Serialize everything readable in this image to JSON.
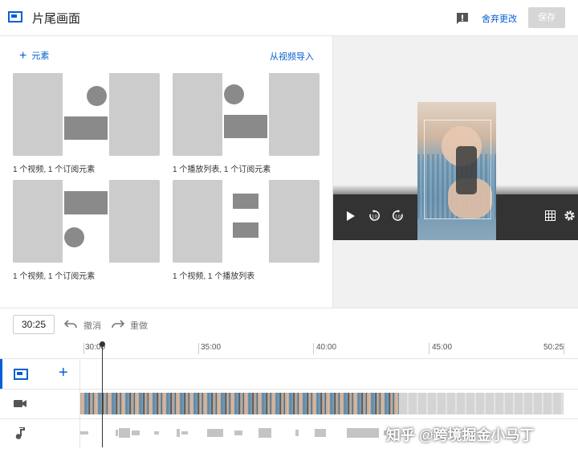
{
  "header": {
    "title": "片尾画面",
    "discard_label": "舍弃更改",
    "save_label": "保存"
  },
  "left_panel": {
    "add_element_label": "元素",
    "import_label": "从视频导入",
    "templates": [
      {
        "label": "1 个视频, 1 个订阅元素"
      },
      {
        "label": "1 个播放列表, 1 个订阅元素"
      },
      {
        "label": "1 个视频, 1 个订阅元素"
      },
      {
        "label": "1 个视频, 1 个播放列表"
      }
    ]
  },
  "timeline": {
    "current_time": "30:25",
    "undo_label": "撤消",
    "redo_label": "重做",
    "ruler_ticks": [
      "30:00",
      "35:00",
      "40:00",
      "45:00",
      "50:25"
    ]
  },
  "watermark": "知乎 @跨境掘金小马丁",
  "colors": {
    "accent": "#065fd4",
    "save_disabled": "#d6d6d6",
    "placeholder": "#cccccc"
  },
  "icons": [
    "end-screen-icon",
    "feedback-icon",
    "plus-icon",
    "play-icon",
    "rewind-10-icon",
    "forward-10-icon",
    "volume-icon",
    "grid-icon",
    "settings-icon",
    "undo-icon",
    "redo-icon",
    "video-camera-icon",
    "music-note-icon"
  ]
}
